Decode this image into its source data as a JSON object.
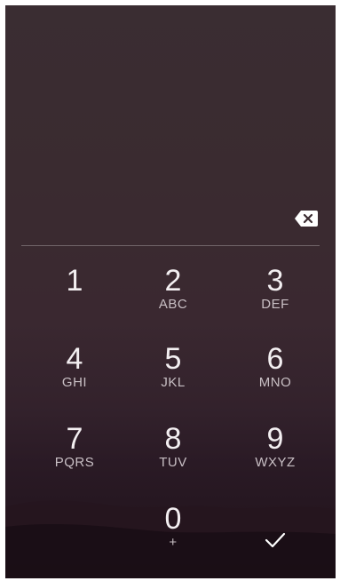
{
  "keypad": {
    "keys": [
      {
        "digit": "1",
        "letters": ""
      },
      {
        "digit": "2",
        "letters": "ABC"
      },
      {
        "digit": "3",
        "letters": "DEF"
      },
      {
        "digit": "4",
        "letters": "GHI"
      },
      {
        "digit": "5",
        "letters": "JKL"
      },
      {
        "digit": "6",
        "letters": "MNO"
      },
      {
        "digit": "7",
        "letters": "PQRS"
      },
      {
        "digit": "8",
        "letters": "TUV"
      },
      {
        "digit": "9",
        "letters": "WXYZ"
      },
      {
        "digit": "0",
        "letters": "+"
      }
    ]
  },
  "icons": {
    "backspace": "backspace-icon",
    "confirm": "checkmark-icon"
  },
  "colors": {
    "background_top": "#3a2d32",
    "background_bottom": "#1e1119",
    "text": "#f3eff1"
  }
}
